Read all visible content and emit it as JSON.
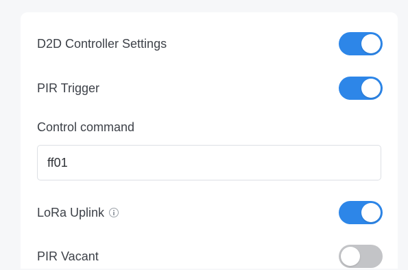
{
  "settings": {
    "d2d_controller": {
      "label": "D2D Controller Settings",
      "enabled": true
    },
    "pir_trigger": {
      "label": "PIR Trigger",
      "enabled": true
    },
    "control_command": {
      "label": "Control command",
      "value": "ff01"
    },
    "lora_uplink": {
      "label": "LoRa Uplink",
      "enabled": true,
      "icon": "info-icon"
    },
    "pir_vacant": {
      "label": "PIR Vacant",
      "enabled": false
    }
  },
  "colors": {
    "toggle_on": "#2d86e8",
    "toggle_off": "#c3c4c7"
  }
}
